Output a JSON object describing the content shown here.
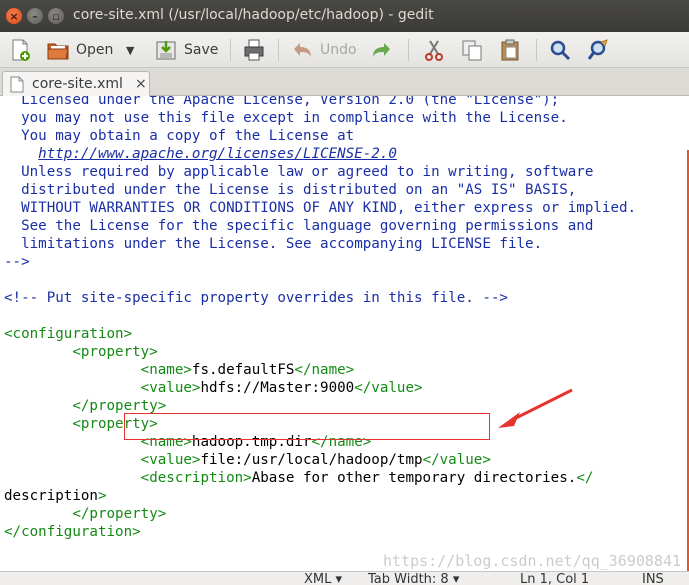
{
  "window": {
    "title": "core-site.xml (/usr/local/hadoop/etc/hadoop) - gedit",
    "controls": [
      "close-icon",
      "minimize-icon",
      "maximize-icon"
    ]
  },
  "toolbar": {
    "open_label": "Open",
    "save_label": "Save",
    "undo_label": "Undo"
  },
  "tab": {
    "label": "core-site.xml",
    "close": "×"
  },
  "editor": {
    "lines": [
      "  Licensed under the Apache License, Version 2.0 (the \"License\");",
      "  you may not use this file except in compliance with the License.",
      "  You may obtain a copy of the License at",
      "",
      "    http://www.apache.org/licenses/LICENSE-2.0",
      "",
      "  Unless required by applicable law or agreed to in writing, software",
      "  distributed under the License is distributed on an \"AS IS\" BASIS,",
      "  WITHOUT WARRANTIES OR CONDITIONS OF ANY KIND, either express or implied.",
      "  See the License for the specific language governing permissions and",
      "  limitations under the License. See accompanying LICENSE file.",
      "-->",
      "",
      "<!-- Put site-specific property overrides in this file. -->",
      "",
      "<configuration>",
      "        <property>",
      "                <name>fs.defaultFS</name>",
      "                <value>hdfs://Master:9000</value>",
      "        </property>",
      "        <property>",
      "                <name>hadoop.tmp.dir</name>",
      "                <value>file:/usr/local/hadoop/tmp</value>",
      "                <description>Abase for other temporary directories.</",
      "description>",
      "        </property>",
      "</configuration>"
    ]
  },
  "watermark": "https://blog.csdn.net/qq_36908841",
  "statusbar": {
    "language": "XML ▾",
    "tab_width": "Tab Width: 8 ▾",
    "position": "Ln 1, Col 1",
    "mode": "INS"
  },
  "colors": {
    "comment": "#1a2fa6",
    "tag": "#148a14",
    "highlight_box": "#e8342f",
    "arrow": "#e8342f"
  }
}
